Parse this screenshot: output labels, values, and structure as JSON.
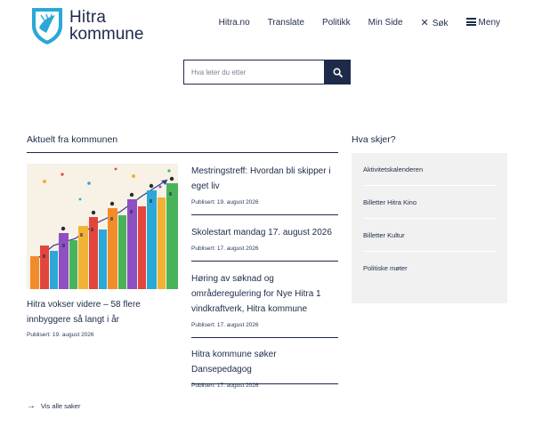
{
  "header": {
    "logo": {
      "line1": "Hitra",
      "line2": "kommune"
    },
    "nav": [
      {
        "label": "Hitra.no"
      },
      {
        "label": "Translate"
      },
      {
        "label": "Politikk"
      },
      {
        "label": "Min Side"
      },
      {
        "label": "Søk",
        "icon": "close-icon"
      },
      {
        "label": "Meny",
        "icon": "hamburger-icon"
      }
    ]
  },
  "search": {
    "placeholder": "Hva leter du etter",
    "icon": "search-icon"
  },
  "news": {
    "title": "Aktuelt fra kommunen",
    "featured": {
      "title": "Hitra vokser videre – 58 flere innbyggere så langt i år",
      "date": "Publisert: 19. august 2026"
    },
    "articles": [
      {
        "title": "Mestringstreff: Hvordan bli skipper i eget liv",
        "date": "Publisert: 19. august 2026"
      },
      {
        "title": "Skolestart mandag 17. august 2026",
        "date": "Publisert: 17. august 2026"
      },
      {
        "title": "Høring av søknad og områderegulering for Nye Hitra 1 vindkraftverk, Hitra kommune",
        "date": "Publisert: 17. august 2026"
      },
      {
        "title": "Hitra kommune søker Dansepedagog",
        "date": "Publisert: 17. august 2026"
      }
    ],
    "see_all": "Vis alle saker"
  },
  "events": {
    "title": "Hva skjer?",
    "items": [
      {
        "label": "Aktivitetskalenderen"
      },
      {
        "label": "Billetter Hitra Kino"
      },
      {
        "label": "Billetter Kultur"
      },
      {
        "label": "Politiske møter"
      }
    ]
  },
  "colors": {
    "navy": "#1d2a4a",
    "shield_blue": "#2aa8d8",
    "panel_gray": "#f1f1f1"
  }
}
